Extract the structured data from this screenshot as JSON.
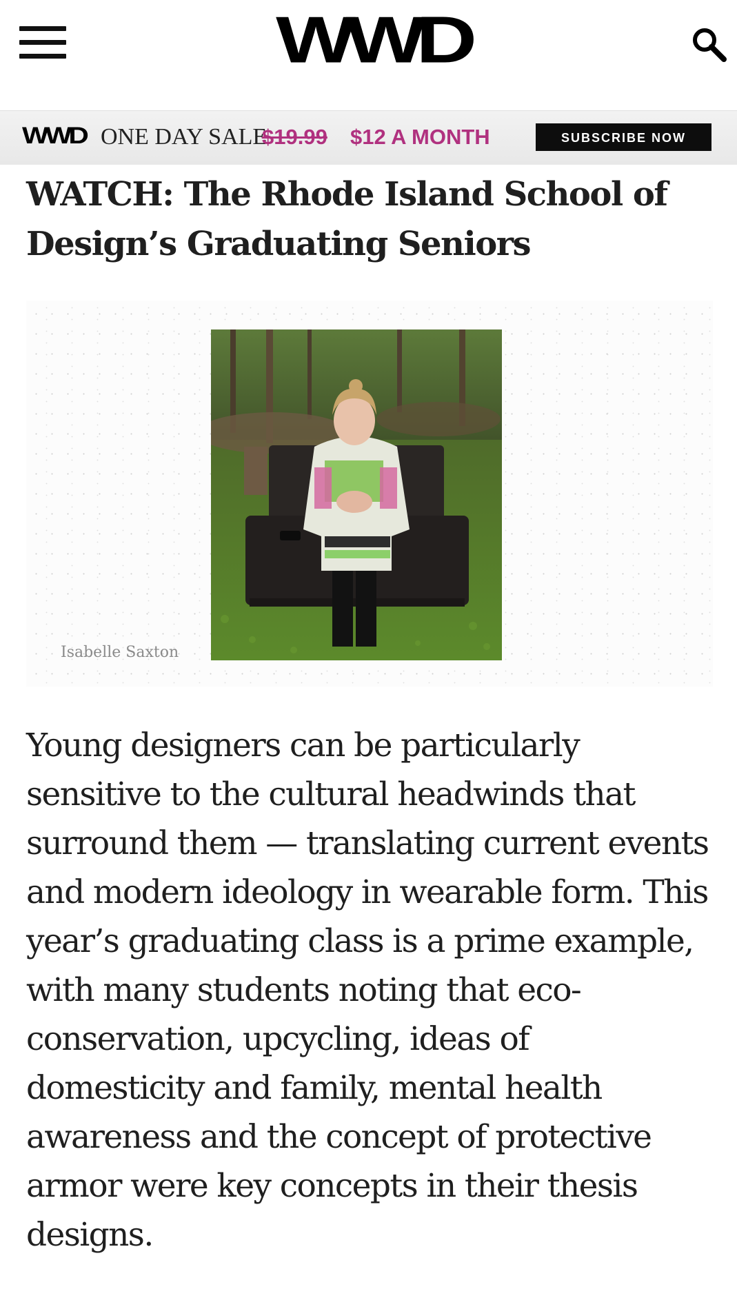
{
  "header": {
    "logo_text": "WWD",
    "menu_icon": "hamburger-menu-icon",
    "search_icon": "search-icon"
  },
  "promo": {
    "logo_text": "WWD",
    "sale_text": "ONE DAY SALE",
    "old_price": "$19.99",
    "new_price": "$12 A MONTH",
    "subscribe_label": "SUBSCRIBE NOW",
    "accent_color": "#b0317f"
  },
  "article": {
    "headline": "WATCH: The Rhode Island School of Design’s Graduating Seniors",
    "photo_credit": "Isabelle Saxton",
    "body": "Young designers can be particularly sensitive to the cultural headwinds that surround them — translating current events and modern ideology in wearable form. This year’s graduating class is a prime example, with many students noting that eco-conservation, upcycling, ideas of domesticity and family, mental health awareness and the concept of protective armor were key concepts in their thesis designs."
  }
}
